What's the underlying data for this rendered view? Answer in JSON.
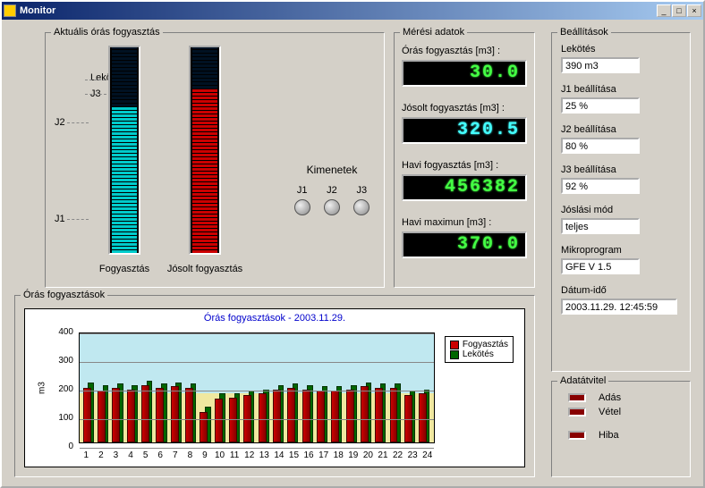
{
  "window": {
    "title": "Monitor"
  },
  "live": {
    "title": "Aktuális órás fogyasztás",
    "bar1_label": "Fogyasztás",
    "bar2_label": "Jósolt fogyasztás",
    "scale": {
      "lekotes": "Lekötés",
      "j1": "J1",
      "j2": "J2",
      "j3": "J3"
    },
    "kimenetek": {
      "title": "Kimenetek",
      "j1": "J1",
      "j2": "J2",
      "j3": "J3"
    },
    "bar1_fill_pct": 70,
    "bar2_fill_pct": 80
  },
  "meas": {
    "title": "Mérési adatok",
    "items": [
      {
        "label": "Órás fogyasztás [m3] :",
        "value": "30.0",
        "cls": "green"
      },
      {
        "label": "Jósolt fogyasztás [m3] :",
        "value": "320.5",
        "cls": "cyan"
      },
      {
        "label": "Havi fogyasztás [m3] :",
        "value": "456382",
        "cls": "green"
      },
      {
        "label": "Havi maximun [m3] :",
        "value": "370.0",
        "cls": "green"
      }
    ]
  },
  "settings": {
    "title": "Beállítások",
    "items": [
      {
        "label": "Lekötés",
        "value": "390 m3"
      },
      {
        "label": "J1 beállítása",
        "value": "25 %"
      },
      {
        "label": "J2 beállítása",
        "value": "80 %"
      },
      {
        "label": "J3 beállítása",
        "value": "92 %"
      },
      {
        "label": "Jóslási mód",
        "value": "teljes"
      },
      {
        "label": "Mikroprogram",
        "value": "GFE V 1.5"
      },
      {
        "label": "Dátum-idő",
        "value": "2003.11.29. 12:45:59",
        "wide": true
      }
    ]
  },
  "hourly": {
    "title": "Órás fogyasztások",
    "legend": {
      "a": "Fogyasztás",
      "b": "Lekötés"
    }
  },
  "datatrans": {
    "title": "Adatátvitel",
    "adas": "Adás",
    "vetel": "Vétel",
    "hiba": "Hiba"
  },
  "chart_data": {
    "type": "bar",
    "title": "Órás fogyasztások - 2003.11.29.",
    "xlabel": "",
    "ylabel": "m3",
    "ylim": [
      0,
      400
    ],
    "yticks": [
      0,
      100,
      200,
      300,
      400
    ],
    "categories": [
      1,
      2,
      3,
      4,
      5,
      6,
      7,
      8,
      9,
      10,
      11,
      12,
      13,
      14,
      15,
      16,
      17,
      18,
      19,
      20,
      21,
      22,
      23,
      24
    ],
    "series": [
      {
        "name": "Fogyasztás",
        "values": [
          200,
          190,
          200,
          195,
          210,
          200,
          205,
          200,
          110,
          160,
          165,
          175,
          180,
          195,
          200,
          195,
          190,
          190,
          195,
          205,
          200,
          200,
          175,
          180
        ]
      },
      {
        "name": "Lekötés",
        "values": [
          220,
          210,
          215,
          210,
          225,
          215,
          220,
          215,
          130,
          180,
          180,
          190,
          195,
          210,
          215,
          210,
          205,
          205,
          210,
          220,
          215,
          215,
          190,
          195
        ]
      }
    ]
  }
}
